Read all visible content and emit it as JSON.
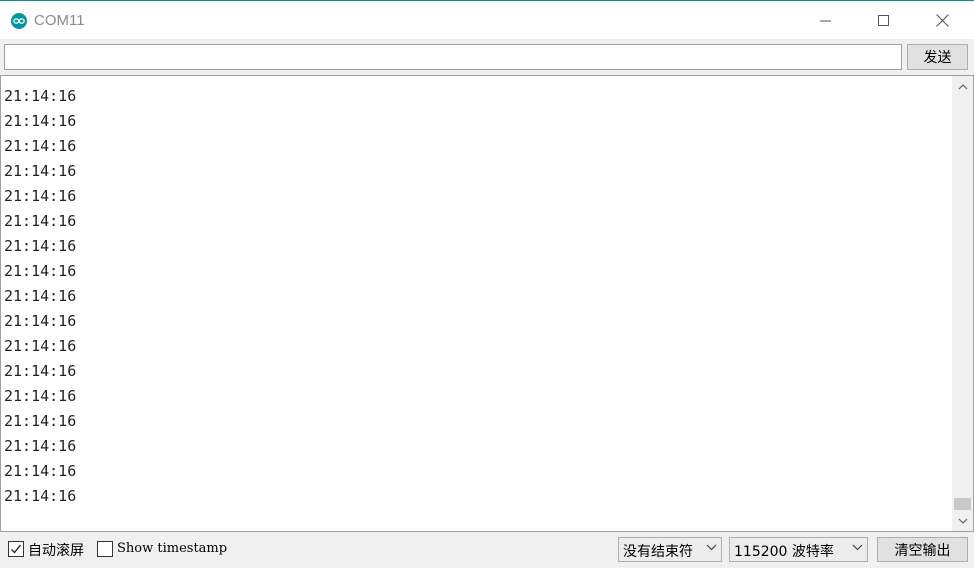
{
  "window": {
    "title": "COM11",
    "accent": "#00979c"
  },
  "input": {
    "value": "",
    "send_label": "发送"
  },
  "output": {
    "lines": [
      "21:14:16",
      "21:14:16",
      "21:14:16",
      "21:14:16",
      "21:14:16",
      "21:14:16",
      "21:14:16",
      "21:14:16",
      "21:14:16",
      "21:14:16",
      "21:14:16",
      "21:14:16",
      "21:14:16",
      "21:14:16",
      "21:14:16",
      "21:14:16",
      "21:14:16"
    ]
  },
  "bottom": {
    "autoscroll_label": "自动滚屏",
    "autoscroll_checked": true,
    "timestamp_label": "Show timestamp",
    "timestamp_checked": false,
    "line_ending": "没有结束符",
    "baud_rate": "115200 波特率",
    "clear_label": "清空输出"
  }
}
